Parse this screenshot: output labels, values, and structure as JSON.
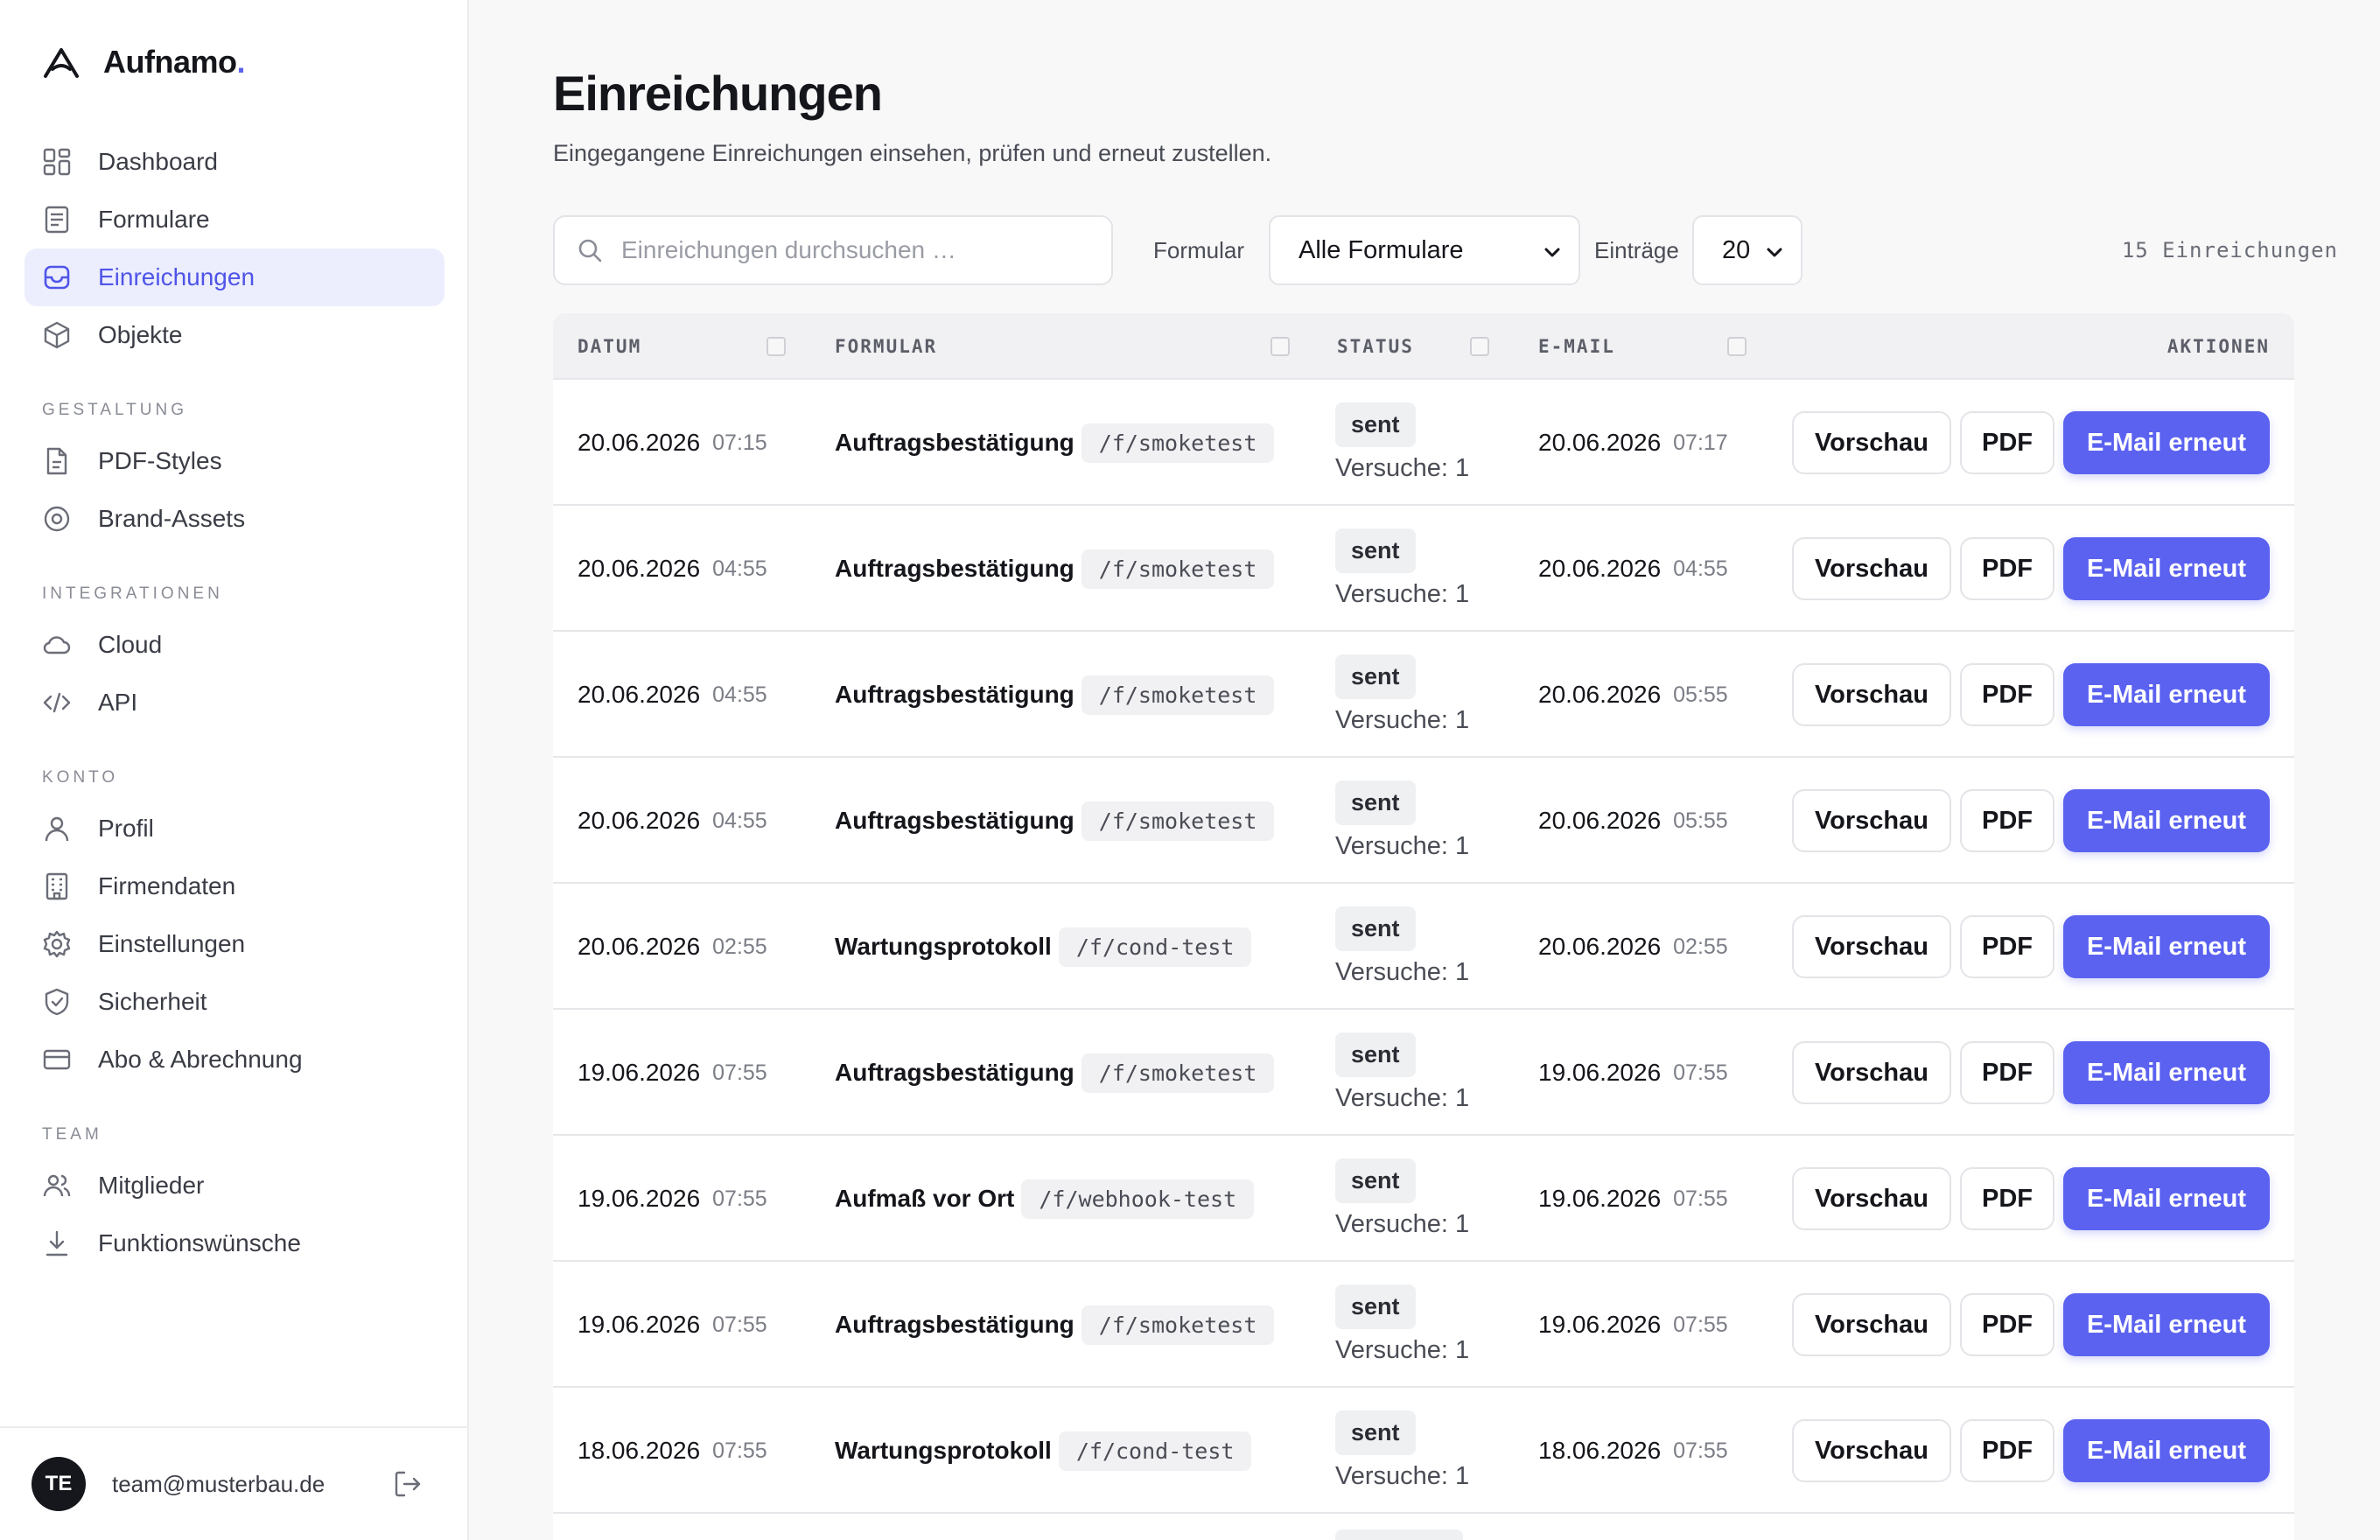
{
  "app": {
    "brand_name": "Aufnamo",
    "brand_dot": ".",
    "accent": "#5b62f0"
  },
  "sidebar": {
    "items_top": [
      {
        "label": "Dashboard",
        "icon": "dashboard-grid-icon"
      },
      {
        "label": "Formulare",
        "icon": "form-document-icon"
      },
      {
        "label": "Einreichungen",
        "icon": "inbox-tray-icon",
        "active": true
      },
      {
        "label": "Objekte",
        "icon": "cube-icon"
      }
    ],
    "section_gestaltung": "GESTALTUNG",
    "items_gestaltung": [
      {
        "label": "PDF-Styles",
        "icon": "pdf-file-icon"
      },
      {
        "label": "Brand-Assets",
        "icon": "target-circle-icon"
      }
    ],
    "section_integrationen": "INTEGRATIONEN",
    "items_integrationen": [
      {
        "label": "Cloud",
        "icon": "cloud-icon"
      },
      {
        "label": "API",
        "icon": "code-brackets-icon"
      }
    ],
    "section_konto": "KONTO",
    "items_konto": [
      {
        "label": "Profil",
        "icon": "user-icon"
      },
      {
        "label": "Firmendaten",
        "icon": "building-icon"
      },
      {
        "label": "Einstellungen",
        "icon": "gear-icon"
      },
      {
        "label": "Sicherheit",
        "icon": "shield-check-icon"
      },
      {
        "label": "Abo & Abrechnung",
        "icon": "credit-card-icon"
      }
    ],
    "section_team": "TEAM",
    "items_team": [
      {
        "label": "Mitglieder",
        "icon": "users-icon"
      },
      {
        "label": "Funktionswünsche",
        "icon": "download-arrow-icon"
      }
    ],
    "user": {
      "initials": "TE",
      "email": "team@musterbau.de"
    }
  },
  "page": {
    "title": "Einreichungen",
    "subtitle": "Eingegangene Einreichungen einsehen, prüfen und erneut zustellen."
  },
  "toolbar": {
    "search_placeholder": "Einreichungen durchsuchen …",
    "form_label": "Formular",
    "form_selected": "Alle Formulare",
    "entries_label": "Einträge",
    "entries_selected": "20",
    "count_text": "15 Einreichungen"
  },
  "table": {
    "headers": {
      "datum": "DATUM",
      "formular": "FORMULAR",
      "status": "STATUS",
      "email": "E-MAIL",
      "aktionen": "AKTIONEN"
    },
    "actions": {
      "preview": "Vorschau",
      "pdf": "PDF",
      "resend": "E-Mail erneut"
    },
    "rows": [
      {
        "date": "20.06.2026",
        "time": "07:15",
        "form": "Auftragsbestätigung",
        "slug": "/f/smoketest",
        "status": "sent",
        "attempts": "Versuche: 1",
        "email_date": "20.06.2026",
        "email_time": "07:17"
      },
      {
        "date": "20.06.2026",
        "time": "04:55",
        "form": "Auftragsbestätigung",
        "slug": "/f/smoketest",
        "status": "sent",
        "attempts": "Versuche: 1",
        "email_date": "20.06.2026",
        "email_time": "04:55"
      },
      {
        "date": "20.06.2026",
        "time": "04:55",
        "form": "Auftragsbestätigung",
        "slug": "/f/smoketest",
        "status": "sent",
        "attempts": "Versuche: 1",
        "email_date": "20.06.2026",
        "email_time": "05:55"
      },
      {
        "date": "20.06.2026",
        "time": "04:55",
        "form": "Auftragsbestätigung",
        "slug": "/f/smoketest",
        "status": "sent",
        "attempts": "Versuche: 1",
        "email_date": "20.06.2026",
        "email_time": "05:55"
      },
      {
        "date": "20.06.2026",
        "time": "02:55",
        "form": "Wartungsprotokoll",
        "slug": "/f/cond-test",
        "status": "sent",
        "attempts": "Versuche: 1",
        "email_date": "20.06.2026",
        "email_time": "02:55"
      },
      {
        "date": "19.06.2026",
        "time": "07:55",
        "form": "Auftragsbestätigung",
        "slug": "/f/smoketest",
        "status": "sent",
        "attempts": "Versuche: 1",
        "email_date": "19.06.2026",
        "email_time": "07:55"
      },
      {
        "date": "19.06.2026",
        "time": "07:55",
        "form": "Aufmaß vor Ort",
        "slug": "/f/webhook-test",
        "status": "sent",
        "attempts": "Versuche: 1",
        "email_date": "19.06.2026",
        "email_time": "07:55"
      },
      {
        "date": "19.06.2026",
        "time": "07:55",
        "form": "Auftragsbestätigung",
        "slug": "/f/smoketest",
        "status": "sent",
        "attempts": "Versuche: 1",
        "email_date": "19.06.2026",
        "email_time": "07:55"
      },
      {
        "date": "18.06.2026",
        "time": "07:55",
        "form": "Wartungsprotokoll",
        "slug": "/f/cond-test",
        "status": "sent",
        "attempts": "Versuche: 1",
        "email_date": "18.06.2026",
        "email_time": "07:55"
      }
    ]
  }
}
